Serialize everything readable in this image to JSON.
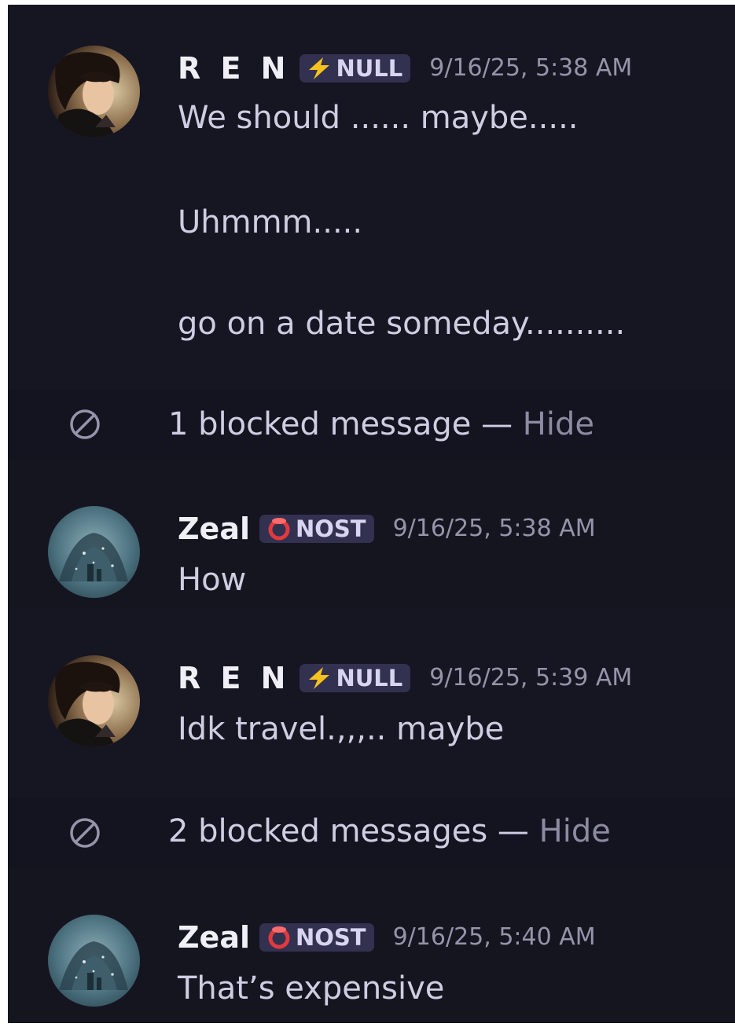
{
  "messages": [
    {
      "author": "R E N",
      "badge": "NULL",
      "badge_icon": "lightning-bolt-icon",
      "timestamp": "9/16/25, 5:38 AM",
      "lines": [
        "We should ...... maybe.....",
        "Uhmmm.....",
        "go on a date someday.........."
      ]
    },
    {
      "author": "Zeal",
      "badge": "NOST",
      "badge_icon": "red-pacifier-icon",
      "timestamp": "9/16/25, 5:38 AM",
      "lines": [
        "How"
      ]
    },
    {
      "author": "R E N",
      "badge": "NULL",
      "badge_icon": "lightning-bolt-icon",
      "timestamp": "9/16/25, 5:39 AM",
      "lines": [
        "Idk travel.,,,.. maybe"
      ]
    },
    {
      "author": "Zeal",
      "badge": "NOST",
      "badge_icon": "red-pacifier-icon",
      "timestamp": "9/16/25, 5:40 AM",
      "lines": [
        "That’s expensive"
      ]
    }
  ],
  "blocked_notices": [
    {
      "text": "1 blocked message",
      "separator": " — ",
      "action": "Hide"
    },
    {
      "text": "2 blocked messages",
      "separator": " — ",
      "action": "Hide"
    }
  ],
  "colors": {
    "background": "#161622",
    "username": "#f0eff6",
    "message_text": "#cfcde2",
    "timestamp": "#9693aa",
    "badge_bg": "#323150",
    "bolt": "#f6c21c",
    "nost_badge_red": "#e03a3f",
    "hide_link": "#8d8aa2"
  }
}
